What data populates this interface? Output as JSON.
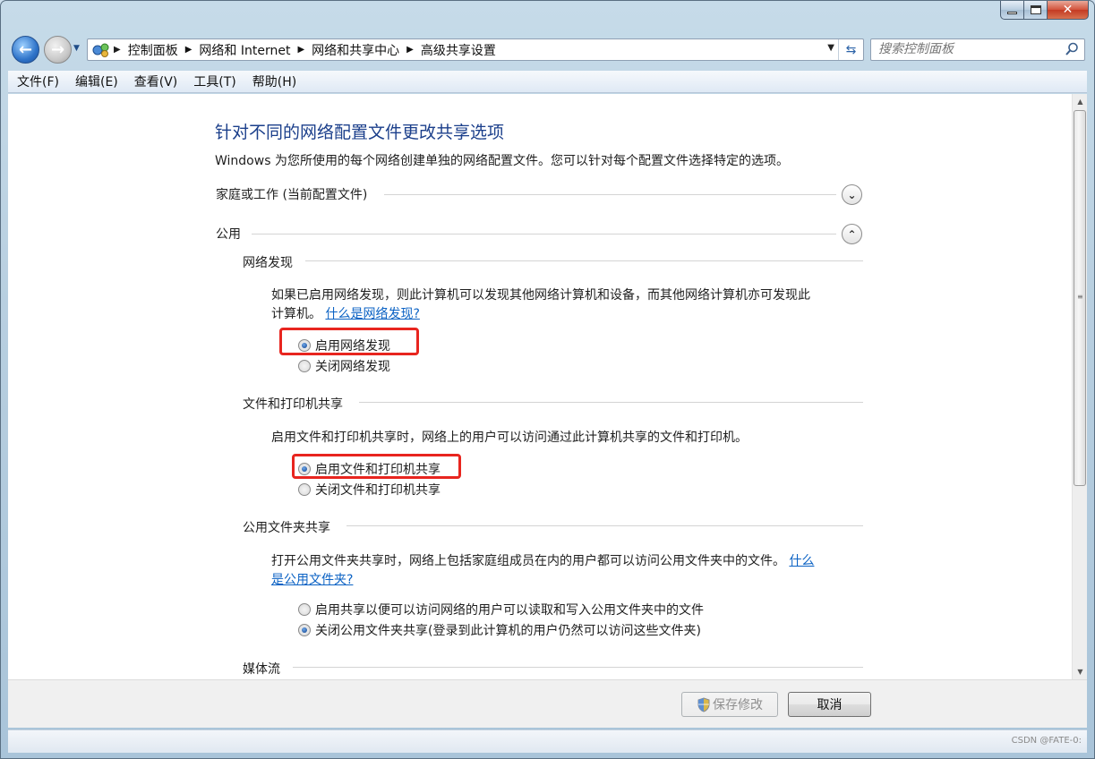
{
  "window": {
    "caption": {
      "minimize": "",
      "maximize": "",
      "close": "✕"
    }
  },
  "nav": {
    "breadcrumbs": [
      "控制面板",
      "网络和 Internet",
      "网络和共享中心",
      "高级共享设置"
    ],
    "search_placeholder": "搜索控制面板"
  },
  "menu": [
    "文件(F)",
    "编辑(E)",
    "查看(V)",
    "工具(T)",
    "帮助(H)"
  ],
  "main": {
    "title": "针对不同的网络配置文件更改共享选项",
    "description": "Windows 为您所使用的每个网络创建单独的网络配置文件。您可以针对每个配置文件选择特定的选项。",
    "profiles": [
      {
        "label": "家庭或工作 (当前配置文件)",
        "expanded": false
      },
      {
        "label": "公用",
        "expanded": true
      }
    ],
    "sections": {
      "network_discovery": {
        "heading": "网络发现",
        "text": "如果已启用网络发现，则此计算机可以发现其他网络计算机和设备，而其他网络计算机亦可发现此",
        "text2": "计算机。",
        "link": "什么是网络发现?",
        "options": [
          {
            "label": "启用网络发现",
            "selected": true
          },
          {
            "label": "关闭网络发现",
            "selected": false
          }
        ]
      },
      "file_printer_sharing": {
        "heading": "文件和打印机共享",
        "text": "启用文件和打印机共享时，网络上的用户可以访问通过此计算机共享的文件和打印机。",
        "options": [
          {
            "label": "启用文件和打印机共享",
            "selected": true
          },
          {
            "label": "关闭文件和打印机共享",
            "selected": false
          }
        ]
      },
      "public_folder_sharing": {
        "heading": "公用文件夹共享",
        "text": "打开公用文件夹共享时，网络上包括家庭组成员在内的用户都可以访问公用文件夹中的文件。",
        "link_part1": "什么",
        "link_part2": "是公用文件夹?",
        "options": [
          {
            "label": "启用共享以便可以访问网络的用户可以读取和写入公用文件夹中的文件",
            "selected": false
          },
          {
            "label": "关闭公用文件夹共享(登录到此计算机的用户仍然可以访问这些文件夹)",
            "selected": true
          }
        ]
      },
      "media_streaming": {
        "heading": "媒体流"
      }
    }
  },
  "footer": {
    "save_label": "保存修改",
    "cancel_label": "取消"
  },
  "watermark": "CSDN @FATE-0:",
  "colors": {
    "highlight": "#e8251f",
    "title": "#1b3f8b",
    "link": "#0b62c4"
  }
}
